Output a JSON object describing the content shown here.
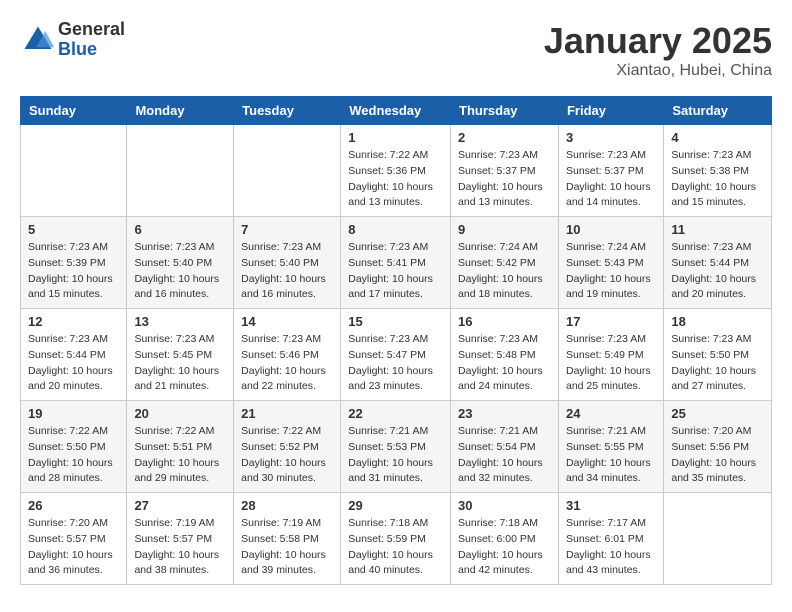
{
  "logo": {
    "general": "General",
    "blue": "Blue"
  },
  "header": {
    "month": "January 2025",
    "location": "Xiantao, Hubei, China"
  },
  "weekdays": [
    "Sunday",
    "Monday",
    "Tuesday",
    "Wednesday",
    "Thursday",
    "Friday",
    "Saturday"
  ],
  "weeks": [
    [
      {
        "day": "",
        "info": ""
      },
      {
        "day": "",
        "info": ""
      },
      {
        "day": "",
        "info": ""
      },
      {
        "day": "1",
        "info": "Sunrise: 7:22 AM\nSunset: 5:36 PM\nDaylight: 10 hours\nand 13 minutes."
      },
      {
        "day": "2",
        "info": "Sunrise: 7:23 AM\nSunset: 5:37 PM\nDaylight: 10 hours\nand 13 minutes."
      },
      {
        "day": "3",
        "info": "Sunrise: 7:23 AM\nSunset: 5:37 PM\nDaylight: 10 hours\nand 14 minutes."
      },
      {
        "day": "4",
        "info": "Sunrise: 7:23 AM\nSunset: 5:38 PM\nDaylight: 10 hours\nand 15 minutes."
      }
    ],
    [
      {
        "day": "5",
        "info": "Sunrise: 7:23 AM\nSunset: 5:39 PM\nDaylight: 10 hours\nand 15 minutes."
      },
      {
        "day": "6",
        "info": "Sunrise: 7:23 AM\nSunset: 5:40 PM\nDaylight: 10 hours\nand 16 minutes."
      },
      {
        "day": "7",
        "info": "Sunrise: 7:23 AM\nSunset: 5:40 PM\nDaylight: 10 hours\nand 16 minutes."
      },
      {
        "day": "8",
        "info": "Sunrise: 7:23 AM\nSunset: 5:41 PM\nDaylight: 10 hours\nand 17 minutes."
      },
      {
        "day": "9",
        "info": "Sunrise: 7:24 AM\nSunset: 5:42 PM\nDaylight: 10 hours\nand 18 minutes."
      },
      {
        "day": "10",
        "info": "Sunrise: 7:24 AM\nSunset: 5:43 PM\nDaylight: 10 hours\nand 19 minutes."
      },
      {
        "day": "11",
        "info": "Sunrise: 7:23 AM\nSunset: 5:44 PM\nDaylight: 10 hours\nand 20 minutes."
      }
    ],
    [
      {
        "day": "12",
        "info": "Sunrise: 7:23 AM\nSunset: 5:44 PM\nDaylight: 10 hours\nand 20 minutes."
      },
      {
        "day": "13",
        "info": "Sunrise: 7:23 AM\nSunset: 5:45 PM\nDaylight: 10 hours\nand 21 minutes."
      },
      {
        "day": "14",
        "info": "Sunrise: 7:23 AM\nSunset: 5:46 PM\nDaylight: 10 hours\nand 22 minutes."
      },
      {
        "day": "15",
        "info": "Sunrise: 7:23 AM\nSunset: 5:47 PM\nDaylight: 10 hours\nand 23 minutes."
      },
      {
        "day": "16",
        "info": "Sunrise: 7:23 AM\nSunset: 5:48 PM\nDaylight: 10 hours\nand 24 minutes."
      },
      {
        "day": "17",
        "info": "Sunrise: 7:23 AM\nSunset: 5:49 PM\nDaylight: 10 hours\nand 25 minutes."
      },
      {
        "day": "18",
        "info": "Sunrise: 7:23 AM\nSunset: 5:50 PM\nDaylight: 10 hours\nand 27 minutes."
      }
    ],
    [
      {
        "day": "19",
        "info": "Sunrise: 7:22 AM\nSunset: 5:50 PM\nDaylight: 10 hours\nand 28 minutes."
      },
      {
        "day": "20",
        "info": "Sunrise: 7:22 AM\nSunset: 5:51 PM\nDaylight: 10 hours\nand 29 minutes."
      },
      {
        "day": "21",
        "info": "Sunrise: 7:22 AM\nSunset: 5:52 PM\nDaylight: 10 hours\nand 30 minutes."
      },
      {
        "day": "22",
        "info": "Sunrise: 7:21 AM\nSunset: 5:53 PM\nDaylight: 10 hours\nand 31 minutes."
      },
      {
        "day": "23",
        "info": "Sunrise: 7:21 AM\nSunset: 5:54 PM\nDaylight: 10 hours\nand 32 minutes."
      },
      {
        "day": "24",
        "info": "Sunrise: 7:21 AM\nSunset: 5:55 PM\nDaylight: 10 hours\nand 34 minutes."
      },
      {
        "day": "25",
        "info": "Sunrise: 7:20 AM\nSunset: 5:56 PM\nDaylight: 10 hours\nand 35 minutes."
      }
    ],
    [
      {
        "day": "26",
        "info": "Sunrise: 7:20 AM\nSunset: 5:57 PM\nDaylight: 10 hours\nand 36 minutes."
      },
      {
        "day": "27",
        "info": "Sunrise: 7:19 AM\nSunset: 5:57 PM\nDaylight: 10 hours\nand 38 minutes."
      },
      {
        "day": "28",
        "info": "Sunrise: 7:19 AM\nSunset: 5:58 PM\nDaylight: 10 hours\nand 39 minutes."
      },
      {
        "day": "29",
        "info": "Sunrise: 7:18 AM\nSunset: 5:59 PM\nDaylight: 10 hours\nand 40 minutes."
      },
      {
        "day": "30",
        "info": "Sunrise: 7:18 AM\nSunset: 6:00 PM\nDaylight: 10 hours\nand 42 minutes."
      },
      {
        "day": "31",
        "info": "Sunrise: 7:17 AM\nSunset: 6:01 PM\nDaylight: 10 hours\nand 43 minutes."
      },
      {
        "day": "",
        "info": ""
      }
    ]
  ]
}
